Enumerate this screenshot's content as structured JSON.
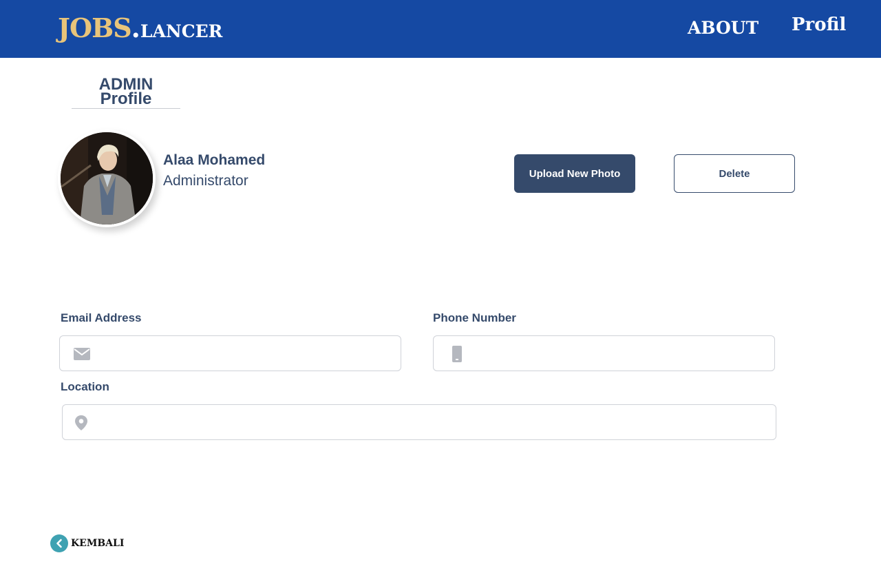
{
  "navbar": {
    "logo_jobs": "JOBS",
    "logo_dot": ".",
    "logo_lancer": "LANCER",
    "about_label": "ABOUT",
    "profil_label": "Profil"
  },
  "page": {
    "heading_line1": "ADMIN",
    "heading_line2": "Profile"
  },
  "profile": {
    "name": "Alaa Mohamed",
    "role": "Administrator",
    "upload_label": "Upload New Photo",
    "delete_label": "Delete"
  },
  "form": {
    "email": {
      "label": "Email Address",
      "value": "",
      "icon": "mail-icon"
    },
    "phone": {
      "label": "Phone Number",
      "value": "",
      "icon": "phone-icon"
    },
    "location": {
      "label": "Location",
      "value": "",
      "icon": "location-pin-icon"
    }
  },
  "footer": {
    "back_label": "KEMBALI",
    "back_icon": "chevron-left-icon"
  },
  "colors": {
    "navbar_bg": "#1549a3",
    "logo_accent": "#e8c47a",
    "primary_text": "#354a6b",
    "back_icon_bg": "#3fa2b2"
  }
}
